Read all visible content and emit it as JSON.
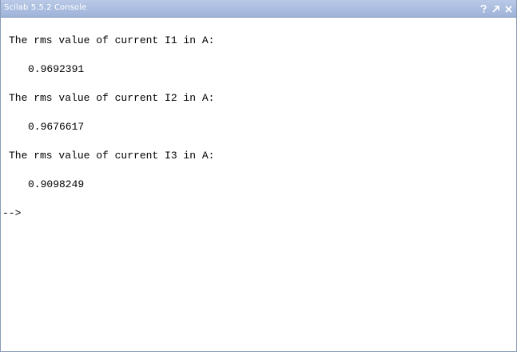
{
  "window": {
    "title": "Scilab 5.5.2 Console",
    "buttons": [
      {
        "name": "help-icon",
        "glyph": "?"
      },
      {
        "name": "undock-icon",
        "glyph": "↗"
      },
      {
        "name": "close-icon",
        "glyph": "✕"
      }
    ]
  },
  "console": {
    "lines": [
      {
        "text": "The rms value of current I1 in A:"
      },
      {
        "text": "0.9692391"
      },
      {
        "text": "The rms value of current I2 in A:"
      },
      {
        "text": "0.9676617"
      },
      {
        "text": "The rms value of current I3 in A:"
      },
      {
        "text": "0.9098249"
      }
    ],
    "prompt": "-->"
  }
}
